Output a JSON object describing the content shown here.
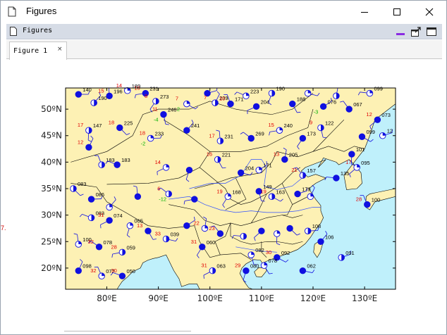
{
  "window": {
    "title": "Figures",
    "app_icon": "document-icon",
    "controls": [
      "minimize-icon",
      "maximize-icon",
      "close-icon"
    ]
  },
  "toolbar": {
    "label": "Figures",
    "icon": "document-icon",
    "buttons": [
      "minimize-icon",
      "undock-icon",
      "maximize-panel-icon"
    ]
  },
  "tab": {
    "label": "Figure 1",
    "close": "×"
  },
  "left_fragment": "7.",
  "colors": {
    "land": "#fdf1b4",
    "sea": "#bff0fb",
    "station": "#1010e0",
    "temperature": "#e00000",
    "dewpoint": "#00b000",
    "pressure": "#000000"
  },
  "chart_data": {
    "type": "scatter",
    "title": "",
    "xlabel": "",
    "ylabel": "",
    "xlim": [
      72,
      136
    ],
    "ylim": [
      16,
      54
    ],
    "xticks": [
      "80ºE",
      "90ºE",
      "100ºE",
      "110ºE",
      "120ºE",
      "130ºE"
    ],
    "yticks": [
      "20ºN",
      "25ºN",
      "30ºN",
      "35ºN",
      "40ºN",
      "45ºN",
      "50ºN"
    ],
    "xtick_values": [
      80,
      90,
      100,
      110,
      120,
      130
    ],
    "ytick_values": [
      20,
      25,
      30,
      35,
      40,
      45,
      50
    ],
    "stations": [
      {
        "lon": 74.5,
        "lat": 52.8,
        "t": "",
        "td": "",
        "p": "140"
      },
      {
        "lon": 77.5,
        "lat": 51.2,
        "t": "",
        "td": "",
        "p": "190"
      },
      {
        "lon": 80.5,
        "lat": 52.5,
        "t": "15",
        "td": "",
        "p": "196"
      },
      {
        "lon": 84.0,
        "lat": 53.5,
        "t": "14",
        "td": "",
        "p": "189"
      },
      {
        "lon": 87.5,
        "lat": 53.0,
        "t": "16",
        "td": "",
        "p": "231"
      },
      {
        "lon": 89.5,
        "lat": 51.5,
        "t": "8",
        "td": "",
        "p": "273"
      },
      {
        "lon": 91.0,
        "lat": 49.0,
        "t": "11",
        "td": "-4",
        "p": "246"
      },
      {
        "lon": 95.5,
        "lat": 51.0,
        "t": "7",
        "td": "2",
        "p": ""
      },
      {
        "lon": 99.5,
        "lat": 53.0,
        "t": "",
        "td": "",
        "p": ""
      },
      {
        "lon": 101.0,
        "lat": 51.2,
        "t": "7",
        "td": "",
        "p": "239"
      },
      {
        "lon": 104.0,
        "lat": 51.0,
        "t": "10",
        "td": "",
        "p": "171"
      },
      {
        "lon": 107.0,
        "lat": 52.5,
        "t": "",
        "td": "",
        "p": "223"
      },
      {
        "lon": 109.0,
        "lat": 50.5,
        "t": "",
        "td": "",
        "p": "204"
      },
      {
        "lon": 112.0,
        "lat": 53.0,
        "t": "",
        "td": "",
        "p": "190"
      },
      {
        "lon": 116.0,
        "lat": 51.0,
        "t": "",
        "td": "",
        "p": "188"
      },
      {
        "lon": 119.0,
        "lat": 53.0,
        "t": "",
        "td": "",
        "p": ""
      },
      {
        "lon": 122.0,
        "lat": 50.5,
        "t": "",
        "td": "-3",
        "p": "076"
      },
      {
        "lon": 124.5,
        "lat": 52.5,
        "t": "",
        "td": "",
        "p": ""
      },
      {
        "lon": 127.0,
        "lat": 50.0,
        "t": "",
        "td": "",
        "p": "067"
      },
      {
        "lon": 131.0,
        "lat": 53.0,
        "t": "",
        "td": "",
        "p": "099"
      },
      {
        "lon": 132.5,
        "lat": 48.0,
        "t": "12",
        "td": "",
        "p": "073"
      },
      {
        "lon": 76.5,
        "lat": 46.0,
        "t": "17",
        "td": "",
        "p": "147"
      },
      {
        "lon": 82.5,
        "lat": 46.5,
        "t": "18",
        "td": "",
        "p": "225"
      },
      {
        "lon": 88.5,
        "lat": 44.5,
        "t": "18",
        "td": "-2",
        "p": "233"
      },
      {
        "lon": 95.5,
        "lat": 46.0,
        "t": "",
        "td": "",
        "p": "241"
      },
      {
        "lon": 102.0,
        "lat": 44.0,
        "t": "17",
        "td": "",
        "p": "231"
      },
      {
        "lon": 108.0,
        "lat": 44.5,
        "t": "",
        "td": "",
        "p": "269"
      },
      {
        "lon": 113.5,
        "lat": 46.0,
        "t": "15",
        "td": "",
        "p": "240"
      },
      {
        "lon": 118.0,
        "lat": 44.5,
        "t": "",
        "td": "",
        "p": "173"
      },
      {
        "lon": 121.5,
        "lat": 46.5,
        "t": "9",
        "td": "",
        "p": "122"
      },
      {
        "lon": 129.5,
        "lat": 44.8,
        "t": "",
        "td": "",
        "p": "099"
      },
      {
        "lon": 133.5,
        "lat": 45.0,
        "t": "",
        "td": "",
        "p": "12"
      },
      {
        "lon": 76.5,
        "lat": 42.8,
        "t": "12",
        "td": "",
        "p": ""
      },
      {
        "lon": 79.0,
        "lat": 39.5,
        "t": "",
        "td": "",
        "p": "183"
      },
      {
        "lon": 82.0,
        "lat": 39.5,
        "t": "",
        "td": "",
        "p": "183"
      },
      {
        "lon": 91.5,
        "lat": 39.0,
        "t": "14",
        "td": "",
        "p": ""
      },
      {
        "lon": 96.0,
        "lat": 38.5,
        "t": "",
        "td": "",
        "p": ""
      },
      {
        "lon": 101.5,
        "lat": 40.5,
        "t": "16",
        "td": "",
        "p": "221"
      },
      {
        "lon": 106.0,
        "lat": 38.0,
        "t": "",
        "td": "",
        "p": "204"
      },
      {
        "lon": 109.5,
        "lat": 38.5,
        "t": "",
        "td": "",
        "p": "171"
      },
      {
        "lon": 114.5,
        "lat": 40.5,
        "t": "13",
        "td": "",
        "p": "205"
      },
      {
        "lon": 118.0,
        "lat": 37.5,
        "t": "21",
        "td": "",
        "p": "157"
      },
      {
        "lon": 124.5,
        "lat": 37.0,
        "t": "",
        "td": "",
        "p": "135"
      },
      {
        "lon": 128.5,
        "lat": 39.0,
        "t": "17",
        "td": "",
        "p": "095"
      },
      {
        "lon": 127.5,
        "lat": 41.5,
        "t": "",
        "td": "",
        "p": "101"
      },
      {
        "lon": 73.5,
        "lat": 35.0,
        "t": "",
        "td": "",
        "p": "083"
      },
      {
        "lon": 77.0,
        "lat": 33.0,
        "t": "",
        "td": "",
        "p": "086"
      },
      {
        "lon": 80.5,
        "lat": 31.5,
        "t": "",
        "td": "",
        "p": ""
      },
      {
        "lon": 86.0,
        "lat": 33.5,
        "t": "",
        "td": "",
        "p": ""
      },
      {
        "lon": 92.0,
        "lat": 34.0,
        "t": "6",
        "td": "-12",
        "p": ""
      },
      {
        "lon": 97.0,
        "lat": 33.0,
        "t": "",
        "td": "",
        "p": ""
      },
      {
        "lon": 103.5,
        "lat": 33.5,
        "t": "19",
        "td": "",
        "p": "168"
      },
      {
        "lon": 109.5,
        "lat": 34.5,
        "t": "",
        "td": "",
        "p": "149"
      },
      {
        "lon": 112.0,
        "lat": 33.5,
        "t": "19",
        "td": "",
        "p": "163"
      },
      {
        "lon": 117.0,
        "lat": 34.0,
        "t": "",
        "td": "",
        "p": "179"
      },
      {
        "lon": 119.5,
        "lat": 33.5,
        "t": "",
        "td": "",
        "p": ""
      },
      {
        "lon": 130.5,
        "lat": 32.0,
        "t": "28",
        "td": "",
        "p": "100"
      },
      {
        "lon": 77.0,
        "lat": 29.5,
        "t": "",
        "td": "",
        "p": "083"
      },
      {
        "lon": 80.5,
        "lat": 29.0,
        "t": "31",
        "td": "",
        "p": "074"
      },
      {
        "lon": 84.5,
        "lat": 28.0,
        "t": "",
        "td": "",
        "p": "065"
      },
      {
        "lon": 88.0,
        "lat": 27.0,
        "t": "13",
        "td": "",
        "p": ""
      },
      {
        "lon": 91.5,
        "lat": 25.5,
        "t": "33",
        "td": "",
        "p": "039"
      },
      {
        "lon": 95.5,
        "lat": 28.0,
        "t": "",
        "td": "",
        "p": ""
      },
      {
        "lon": 99.0,
        "lat": 27.5,
        "t": "22",
        "td": "",
        "p": ""
      },
      {
        "lon": 102.0,
        "lat": 26.5,
        "t": "23",
        "td": "",
        "p": ""
      },
      {
        "lon": 106.5,
        "lat": 26.0,
        "t": "",
        "td": "",
        "p": ""
      },
      {
        "lon": 110.0,
        "lat": 27.0,
        "t": "",
        "td": "",
        "p": ""
      },
      {
        "lon": 113.0,
        "lat": 26.5,
        "t": "",
        "td": "",
        "p": ""
      },
      {
        "lon": 115.5,
        "lat": 27.5,
        "t": "",
        "td": "",
        "p": ""
      },
      {
        "lon": 119.0,
        "lat": 27.0,
        "t": "",
        "td": "",
        "p": "108"
      },
      {
        "lon": 121.5,
        "lat": 25.0,
        "t": "",
        "td": "",
        "p": "106"
      },
      {
        "lon": 74.5,
        "lat": 24.5,
        "t": "",
        "td": "",
        "p": "100"
      },
      {
        "lon": 78.5,
        "lat": 24.0,
        "t": "32",
        "td": "",
        "p": "078"
      },
      {
        "lon": 83.0,
        "lat": 23.0,
        "t": "28",
        "td": "",
        "p": "059"
      },
      {
        "lon": 98.5,
        "lat": 24.0,
        "t": "31",
        "td": "",
        "p": "060"
      },
      {
        "lon": 108.0,
        "lat": 22.5,
        "t": "",
        "td": "",
        "p": "082"
      },
      {
        "lon": 113.0,
        "lat": 22.0,
        "t": "30",
        "td": "",
        "p": "092"
      },
      {
        "lon": 125.5,
        "lat": 22.0,
        "t": "",
        "td": "",
        "p": "091"
      },
      {
        "lon": 74.5,
        "lat": 19.5,
        "t": "",
        "td": "",
        "p": "098"
      },
      {
        "lon": 79.0,
        "lat": 18.5,
        "t": "32",
        "td": "",
        "p": "072"
      },
      {
        "lon": 83.0,
        "lat": 18.5,
        "t": "30",
        "td": "",
        "p": "050"
      },
      {
        "lon": 100.5,
        "lat": 19.5,
        "t": "31",
        "td": "",
        "p": "063"
      },
      {
        "lon": 107.0,
        "lat": 19.5,
        "t": "29",
        "td": "",
        "p": "080"
      },
      {
        "lon": 110.5,
        "lat": 20.5,
        "t": "",
        "td": "",
        "p": "078"
      },
      {
        "lon": 118.0,
        "lat": 19.5,
        "t": "",
        "td": "",
        "p": "062"
      }
    ]
  }
}
